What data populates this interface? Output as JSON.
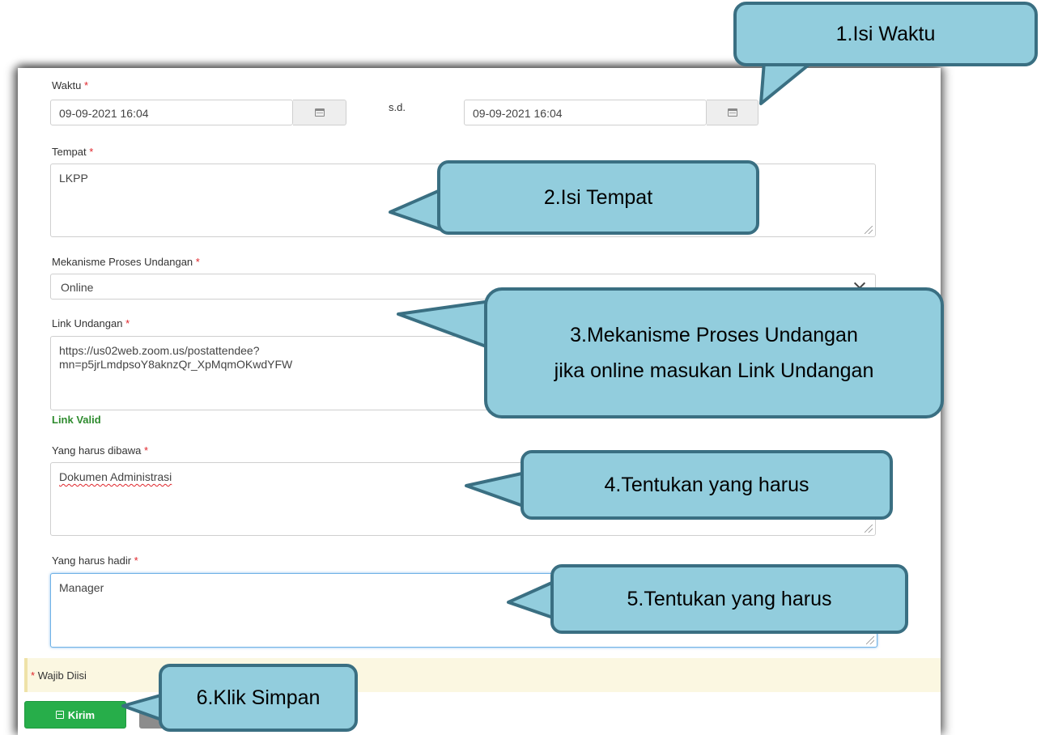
{
  "form": {
    "waktu": {
      "label": "Waktu",
      "required_mark": "*",
      "start_value": "09-09-2021 16:04",
      "separator": "s.d.",
      "end_value": "09-09-2021 16:04"
    },
    "tempat": {
      "label": "Tempat",
      "required_mark": "*",
      "value": "LKPP"
    },
    "mekanisme": {
      "label": "Mekanisme Proses Undangan",
      "required_mark": "*",
      "selected": "Online"
    },
    "link": {
      "label": "Link Undangan",
      "required_mark": "*",
      "value_line1": "https://us02web.zoom.us/postattendee?",
      "value_line2": "mn=p5jrLmdpsoY8aknzQr_XpMqmOKwdYFW",
      "status": "Link Valid"
    },
    "dibawa": {
      "label": "Yang harus dibawa",
      "required_mark": "*",
      "value": "Dokumen Administrasi"
    },
    "hadir": {
      "label": "Yang harus hadir",
      "required_mark": "*",
      "value": "Manager"
    },
    "notice": {
      "mark": "*",
      "text": "Wajib Diisi"
    },
    "submit_label": "Kirim"
  },
  "callouts": {
    "c1": "1.Isi Waktu",
    "c2": "2.Isi Tempat",
    "c3_line1": "3.Mekanisme Proses Undangan",
    "c3_line2": "jika online masukan Link Undangan",
    "c4": "4.Tentukan yang harus",
    "c5": "5.Tentukan yang harus",
    "c6": "6.Klik Simpan"
  },
  "colors": {
    "callout_fill": "#92cddd",
    "callout_border": "#3a6f82",
    "required": "#e0252b",
    "valid": "#2e8b2e",
    "submit_button": "#27ae4a"
  },
  "icons": [
    "calendar-icon",
    "chevron-down-icon",
    "save-icon",
    "resize-handle-icon"
  ]
}
